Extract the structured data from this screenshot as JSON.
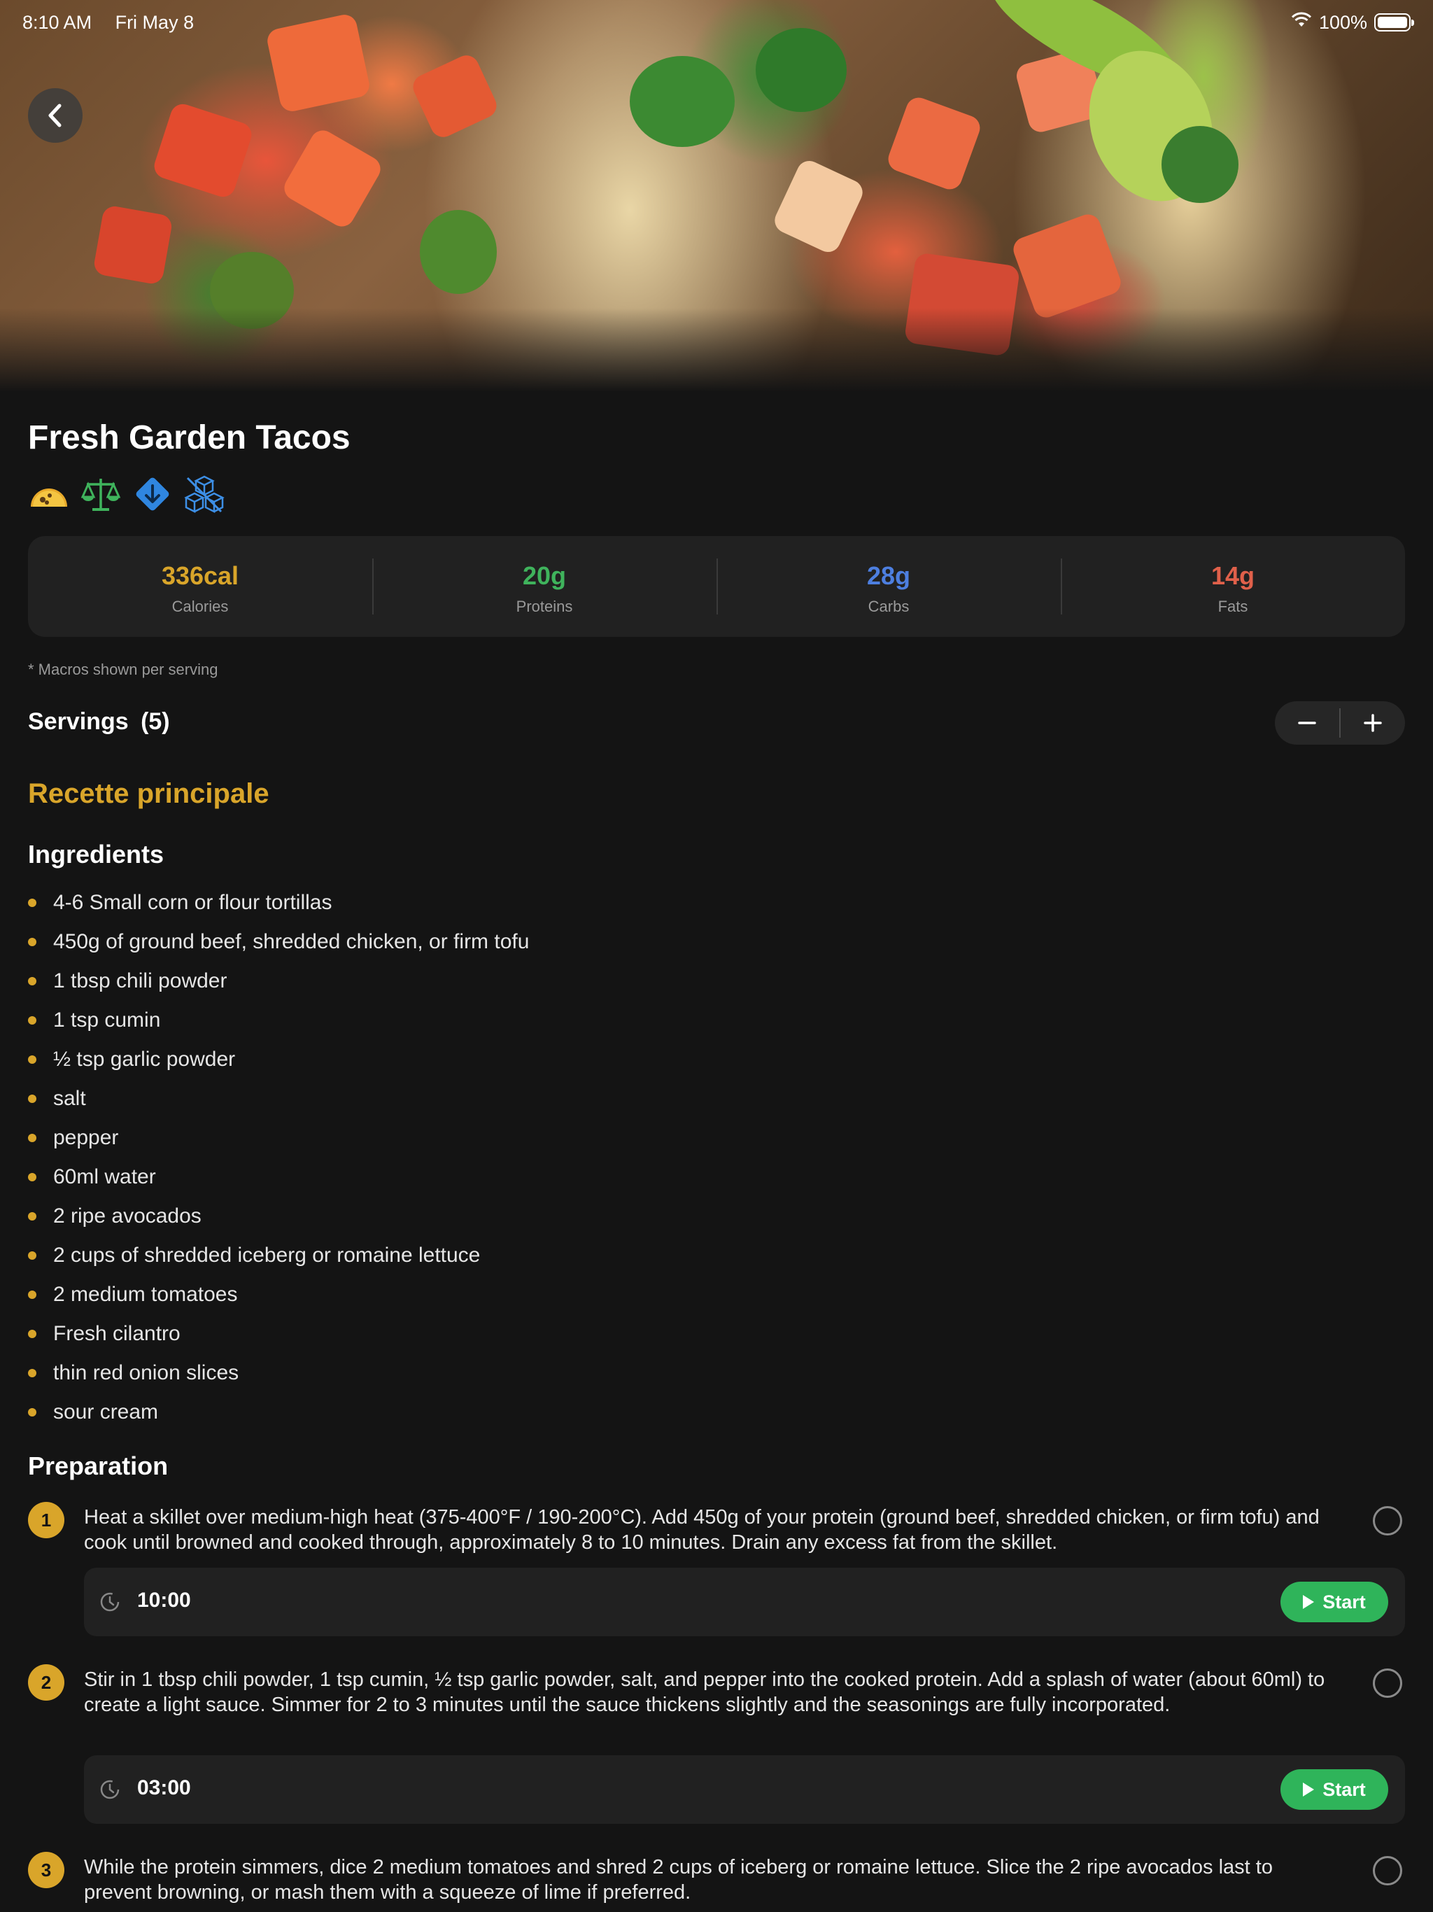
{
  "status_bar": {
    "time": "8:10 AM",
    "date": "Fri May 8",
    "battery": "100%"
  },
  "recipe": {
    "title": "Fresh Garden Tacos",
    "tags": [
      "taco-icon",
      "balance-scale-icon",
      "down-arrow-diamond-icon",
      "cubes-icon"
    ]
  },
  "macros": [
    {
      "value": "336cal",
      "label": "Calories",
      "color": "#d9a52a"
    },
    {
      "value": "20g",
      "label": "Proteins",
      "color": "#3fb35c"
    },
    {
      "value": "28g",
      "label": "Carbs",
      "color": "#4d7fe0"
    },
    {
      "value": "14g",
      "label": "Fats",
      "color": "#e0604a"
    }
  ],
  "macro_note": "* Macros shown per serving",
  "servings": {
    "label": "Servings",
    "count": "(5)"
  },
  "section_title": "Recette principale",
  "ingredients_title": "Ingredients",
  "ingredients": [
    "4-6 Small corn or flour tortillas",
    "450g of ground beef, shredded chicken, or firm tofu",
    "1 tbsp chili powder",
    "1 tsp cumin",
    "½ tsp garlic powder",
    "salt",
    "pepper",
    "60ml water",
    "2 ripe avocados",
    "2 cups of shredded iceberg or romaine lettuce",
    "2 medium tomatoes",
    "Fresh cilantro",
    "thin red onion slices",
    "sour cream"
  ],
  "preparation_title": "Preparation",
  "steps": [
    {
      "number": "1",
      "text": "Heat a skillet over medium-high heat (375-400°F / 190-200°C). Add 450g of your protein (ground beef, shredded chicken, or firm tofu) and cook until browned and cooked through, approximately 8 to 10 minutes. Drain any excess fat from the skillet.",
      "timer": "10:00",
      "start_label": "Start"
    },
    {
      "number": "2",
      "text": "Stir in 1 tbsp chili powder, 1 tsp cumin, ½ tsp garlic powder, salt, and pepper into the cooked protein. Add a splash of water (about 60ml) to create a light sauce. Simmer for 2 to 3 minutes until the sauce thickens slightly and the seasonings are fully incorporated.",
      "timer": "03:00",
      "start_label": "Start"
    },
    {
      "number": "3",
      "text": "While the protein simmers, dice 2 medium tomatoes and shred 2 cups of iceberg or romaine lettuce. Slice the 2 ripe avocados last to prevent browning, or mash them with a squeeze of lime if preferred."
    }
  ]
}
